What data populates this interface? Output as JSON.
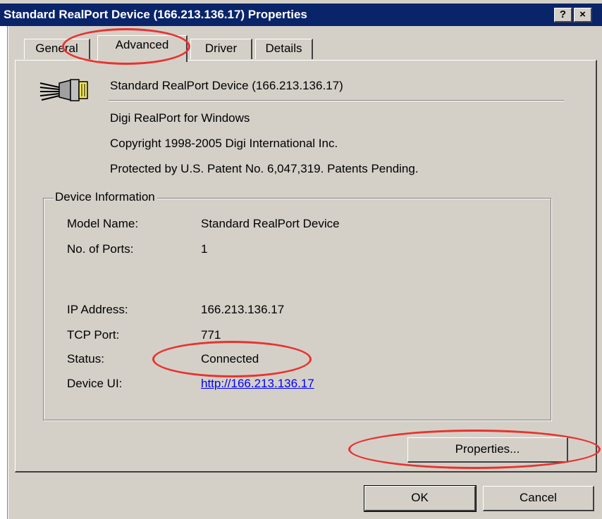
{
  "window": {
    "title": "Standard RealPort Device (166.213.136.17) Properties",
    "help_label": "?",
    "close_label": "×"
  },
  "tabs": [
    {
      "label": "General",
      "active": false
    },
    {
      "label": "Advanced",
      "active": true
    },
    {
      "label": "Driver",
      "active": false
    },
    {
      "label": "Details",
      "active": false
    }
  ],
  "header": {
    "device_name": "Standard RealPort Device (166.213.136.17)",
    "icon": "serial-port-icon"
  },
  "about": {
    "product": "Digi RealPort for Windows",
    "copyright": "Copyright 1998-2005 Digi International Inc.",
    "patent": "Protected by U.S. Patent No. 6,047,319. Patents Pending."
  },
  "device_info": {
    "title": "Device Information",
    "fields": [
      {
        "label": "Model Name:",
        "value": "Standard RealPort Device"
      },
      {
        "label": "No. of Ports:",
        "value": "1"
      },
      {
        "label": "IP Address:",
        "value": "166.213.136.17"
      },
      {
        "label": "TCP Port:",
        "value": "771"
      },
      {
        "label": "Status:",
        "value": "Connected"
      },
      {
        "label": "Device UI:",
        "value": "http://166.213.136.17"
      }
    ]
  },
  "buttons": {
    "properties": "Properties...",
    "ok": "OK",
    "cancel": "Cancel"
  },
  "colors": {
    "titlebar": "#0a246a",
    "face": "#d4d0c8",
    "highlight_ellipse": "#e8332f",
    "link": "#0000ff"
  }
}
